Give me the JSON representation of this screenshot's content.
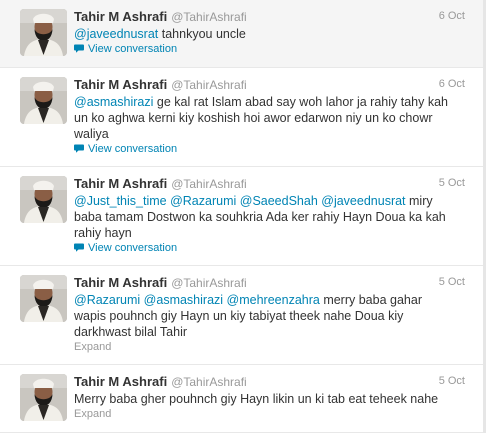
{
  "tweets": [
    {
      "name": "Tahir M Ashrafi",
      "handle": "@TahirAshrafi",
      "date": "6 Oct",
      "lines": [
        [
          {
            "t": "@javeednusrat",
            "m": true
          },
          {
            "t": " tahnkyou uncle"
          }
        ]
      ],
      "action": "View conversation",
      "action_type": "view"
    },
    {
      "name": "Tahir M Ashrafi",
      "handle": "@TahirAshrafi",
      "date": "6 Oct",
      "lines": [
        [
          {
            "t": "@asmashirazi",
            "m": true
          },
          {
            "t": " ge kal rat Islam abad say woh lahor ja rahiy tahy kah"
          }
        ],
        [
          {
            "t": "un ko aghwa kerni kiy koshish hoi awor edarwon niy un ko chowr"
          }
        ],
        [
          {
            "t": "waliya"
          }
        ]
      ],
      "action": "View conversation",
      "action_type": "view"
    },
    {
      "name": "Tahir M Ashrafi",
      "handle": "@TahirAshrafi",
      "date": "5 Oct",
      "lines": [
        [
          {
            "t": "@Just_this_time",
            "m": true
          },
          {
            "t": " "
          },
          {
            "t": "@Razarumi",
            "m": true
          },
          {
            "t": " "
          },
          {
            "t": "@SaeedShah",
            "m": true
          },
          {
            "t": " "
          },
          {
            "t": "@javeednusrat",
            "m": true
          },
          {
            "t": " miry"
          }
        ],
        [
          {
            "t": "baba tamam Dostwon ka souhkria Ada ker rahiy Hayn Doua ka kah"
          }
        ],
        [
          {
            "t": "rahiy hayn"
          }
        ]
      ],
      "action": "View conversation",
      "action_type": "view"
    },
    {
      "name": "Tahir M Ashrafi",
      "handle": "@TahirAshrafi",
      "date": "5 Oct",
      "lines": [
        [
          {
            "t": "@Razarumi",
            "m": true
          },
          {
            "t": " "
          },
          {
            "t": "@asmashirazi",
            "m": true
          },
          {
            "t": " "
          },
          {
            "t": "@mehreenzahra",
            "m": true
          },
          {
            "t": " merry baba gahar"
          }
        ],
        [
          {
            "t": "wapis pouhnch giy Hayn un kiy tabiyat theek nahe Doua kiy"
          }
        ],
        [
          {
            "t": "darkhwast bilal Tahir"
          }
        ]
      ],
      "action": "Expand",
      "action_type": "expand"
    },
    {
      "name": "Tahir M Ashrafi",
      "handle": "@TahirAshrafi",
      "date": "5 Oct",
      "lines": [
        [
          {
            "t": "Merry baba gher pouhnch giy Hayn likin un ki tab eat teheek nahe"
          }
        ]
      ],
      "action": "Expand",
      "action_type": "expand"
    }
  ],
  "colors": {
    "link": "#0084b4",
    "muted": "#999999",
    "text": "#333333",
    "first_bg": "#f5f5f5"
  },
  "icons": {
    "view_conversation": "speech-bubble-icon"
  }
}
